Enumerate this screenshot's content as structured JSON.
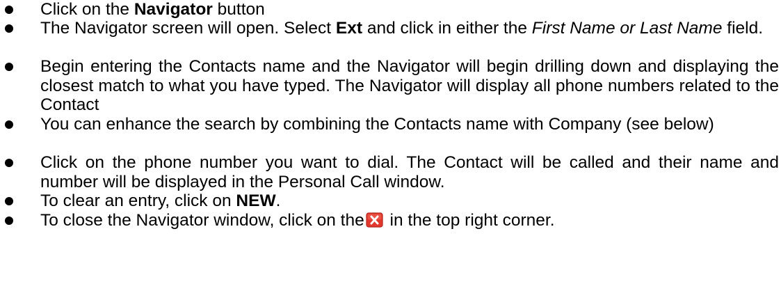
{
  "bullets": [
    {
      "pre": "Click on the ",
      "bold": "Navigator",
      "post": " button"
    },
    {
      "pre": "The Navigator screen will open.  Select ",
      "bold": "Ext",
      "mid": " and click in either the ",
      "italic": "First Name or Last Name",
      "post": " field."
    },
    {
      "text": "Begin entering the Contacts name and the Navigator will begin drilling down and displaying the closest match to what you have typed.  The Navigator will display all phone numbers related to the Contact"
    },
    {
      "text": "You can enhance the search by combining the Contacts name with Company (see below)"
    },
    {
      "text": "Click on the phone number you want to dial.  The Contact will be called and their name and number will be displayed in the Personal Call window."
    },
    {
      "pre": "To clear an entry, click on ",
      "bold": "NEW",
      "post": "."
    },
    {
      "pre": "To close the Navigator window, click on the",
      "icon": "close-icon",
      "post": " in the top right corner."
    }
  ],
  "colors": {
    "text": "#000000",
    "icon_red": "#e2372c",
    "icon_border": "#b3261f"
  }
}
